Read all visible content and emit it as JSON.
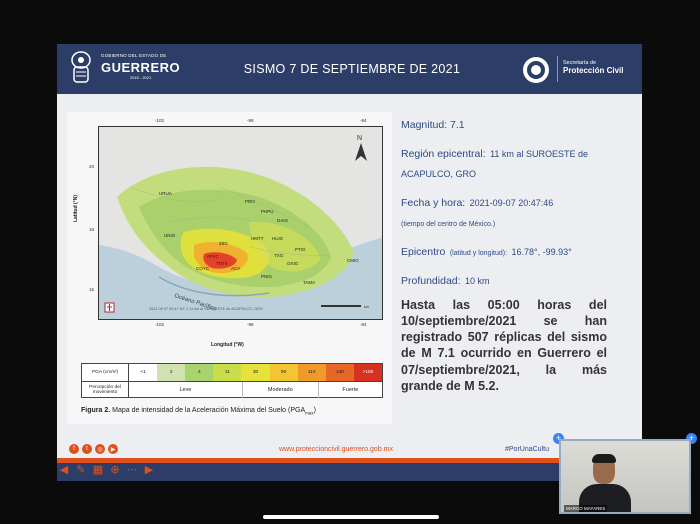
{
  "header": {
    "gov_small": "GOBIERNO DEL ESTADO DE",
    "gov_big": "GUERRERO",
    "gov_years": "2015 - 2021",
    "title": "SISMO 7 DE SEPTIEMBRE DE 2021",
    "pc_line1": "Secretaría de",
    "pc_line2": "Protección Civil"
  },
  "map": {
    "x_ticks": [
      "-102",
      "-98",
      "-94"
    ],
    "y_ticks": [
      "20",
      "18",
      "16"
    ],
    "ylabel": "Latitud (°N)",
    "xlabel": "Longitud (°W)",
    "ocean_label": "Océano Pacífico",
    "north_label": "N",
    "places": [
      "URUA",
      "PRO",
      "PHPU",
      "UNIO",
      "HMTT",
      "HUIG",
      "TXG",
      "ATYC",
      "TNTX",
      "COYC",
      "ACA",
      "OXIG",
      "CMIG",
      "PNIG",
      "TAMA",
      "DAIG",
      "PTIG",
      "ZIIG"
    ],
    "credit": "2021 09 07 20:47 M7.1 11 km al SUROESTE de ACAPULCO, GRO",
    "scale_label": "km"
  },
  "legend": {
    "pga_label": "PGA (cm/s²)",
    "pga_values": [
      "<1",
      "2",
      "4",
      "11",
      "30",
      "90",
      "110",
      "130",
      ">150"
    ],
    "pga_colors": [
      "#ffffff",
      "#cfe2b0",
      "#a8d470",
      "#c8dd48",
      "#e6e23a",
      "#f3c530",
      "#f09a2a",
      "#e76725",
      "#d7321f"
    ],
    "perception_label": "Percepción del movimiento",
    "perception": [
      "Leve",
      "Moderado",
      "Fuerte"
    ]
  },
  "caption": {
    "bold": "Figura 2.",
    "text": " Mapa de intensidad de la Aceleración Máxima del Suelo (PGA",
    "sub": "max",
    "end": ")"
  },
  "info": {
    "magnitude_label": "Magnitud: 7.1",
    "region_label": "Región epicentral:",
    "region_value": "11 km al SUROESTE de ACAPULCO, GRO",
    "date_label": "Fecha y hora:",
    "date_value": "2021-09-07 20:47:46",
    "date_note": "(tiempo del centro de México.)",
    "epicenter_label": "Epicentro",
    "epicenter_note": "(latitud y longitud):",
    "epicenter_value": "16.78°, -99.93°",
    "depth_label": "Profundidad:",
    "depth_value": "10 km",
    "summary": "Hasta las 05:00 horas del 10/septiembre/2021 se han registrado 507 réplicas del sismo de M 7.1 ocurrido en Guerrero el 07/septiembre/2021, la más grande de M 5.2."
  },
  "footer": {
    "url": "www.proteccioncivil.guerrero.gob.mx",
    "hashtag": "#PorUnaCultu"
  },
  "webcam": {
    "name": "MARCO MAYARES"
  }
}
